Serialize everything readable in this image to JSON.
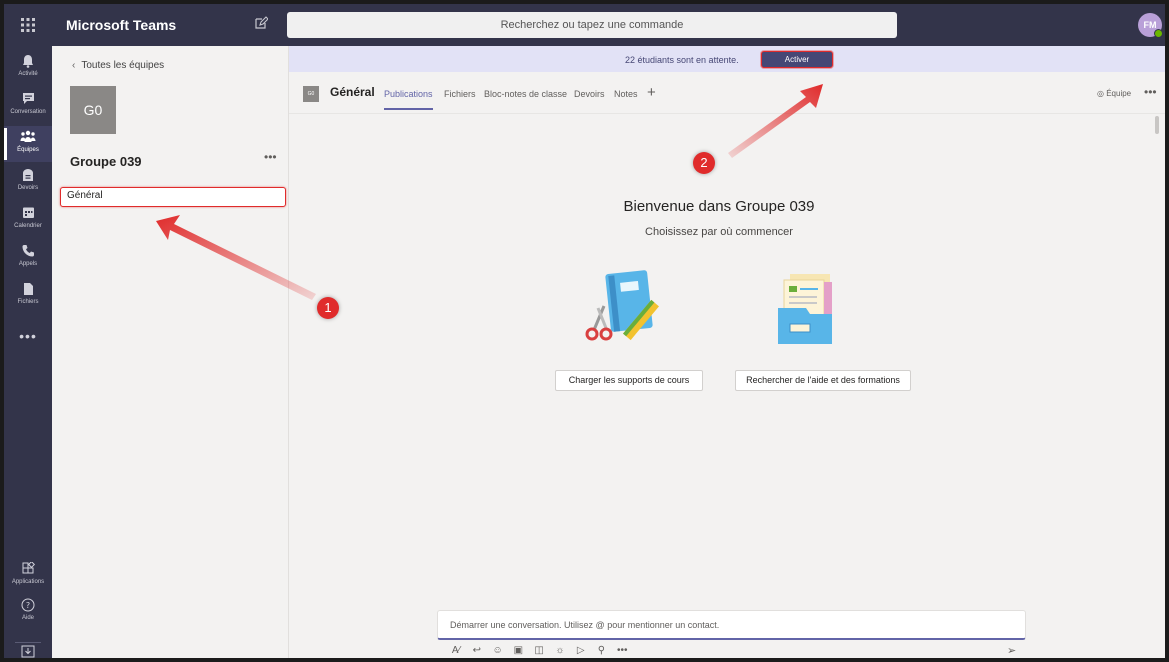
{
  "app": {
    "title": "Microsoft Teams",
    "search_placeholder": "Recherchez ou tapez une commande",
    "avatar_initials": "FM"
  },
  "rail": {
    "items": [
      {
        "label": "Activité",
        "icon": "bell-icon"
      },
      {
        "label": "Conversation",
        "icon": "chat-icon"
      },
      {
        "label": "Équipes",
        "icon": "teams-icon"
      },
      {
        "label": "Devoirs",
        "icon": "assignments-icon"
      },
      {
        "label": "Calendrier",
        "icon": "calendar-icon"
      },
      {
        "label": "Appels",
        "icon": "phone-icon"
      },
      {
        "label": "Fichiers",
        "icon": "files-icon"
      }
    ],
    "more": "•••",
    "apps_label": "Applications",
    "help_label": "Aide"
  },
  "team_panel": {
    "back_label": "Toutes les équipes",
    "team_initials": "G0",
    "team_name": "Groupe 039",
    "more": "•••",
    "channels": [
      {
        "label": "Général"
      }
    ]
  },
  "banner": {
    "text": "22 étudiants sont en attente.",
    "button_label": "Activer"
  },
  "channel": {
    "tile_initials": "G0",
    "title": "Général",
    "tabs": [
      "Publications",
      "Fichiers",
      "Bloc-notes de classe",
      "Devoirs",
      "Notes"
    ],
    "active_tab": "Publications",
    "add_tab": "+",
    "team_view_label": "Équipe",
    "more": "•••"
  },
  "welcome": {
    "title": "Bienvenue dans Groupe 039",
    "subtitle": "Choisissez par où commencer",
    "buttons": [
      "Charger les supports de cours",
      "Rechercher de l'aide et des formations"
    ]
  },
  "compose": {
    "placeholder": "Démarrer une conversation. Utilisez @ pour mentionner un contact.",
    "more": "•••"
  },
  "annotations": {
    "badge_1": "1",
    "badge_2": "2",
    "color": "#e02b2b"
  },
  "colors": {
    "rail_bg": "#33344a",
    "accent": "#6264a7",
    "banner_bg": "#e2e2f6",
    "button_dark": "#464775"
  }
}
